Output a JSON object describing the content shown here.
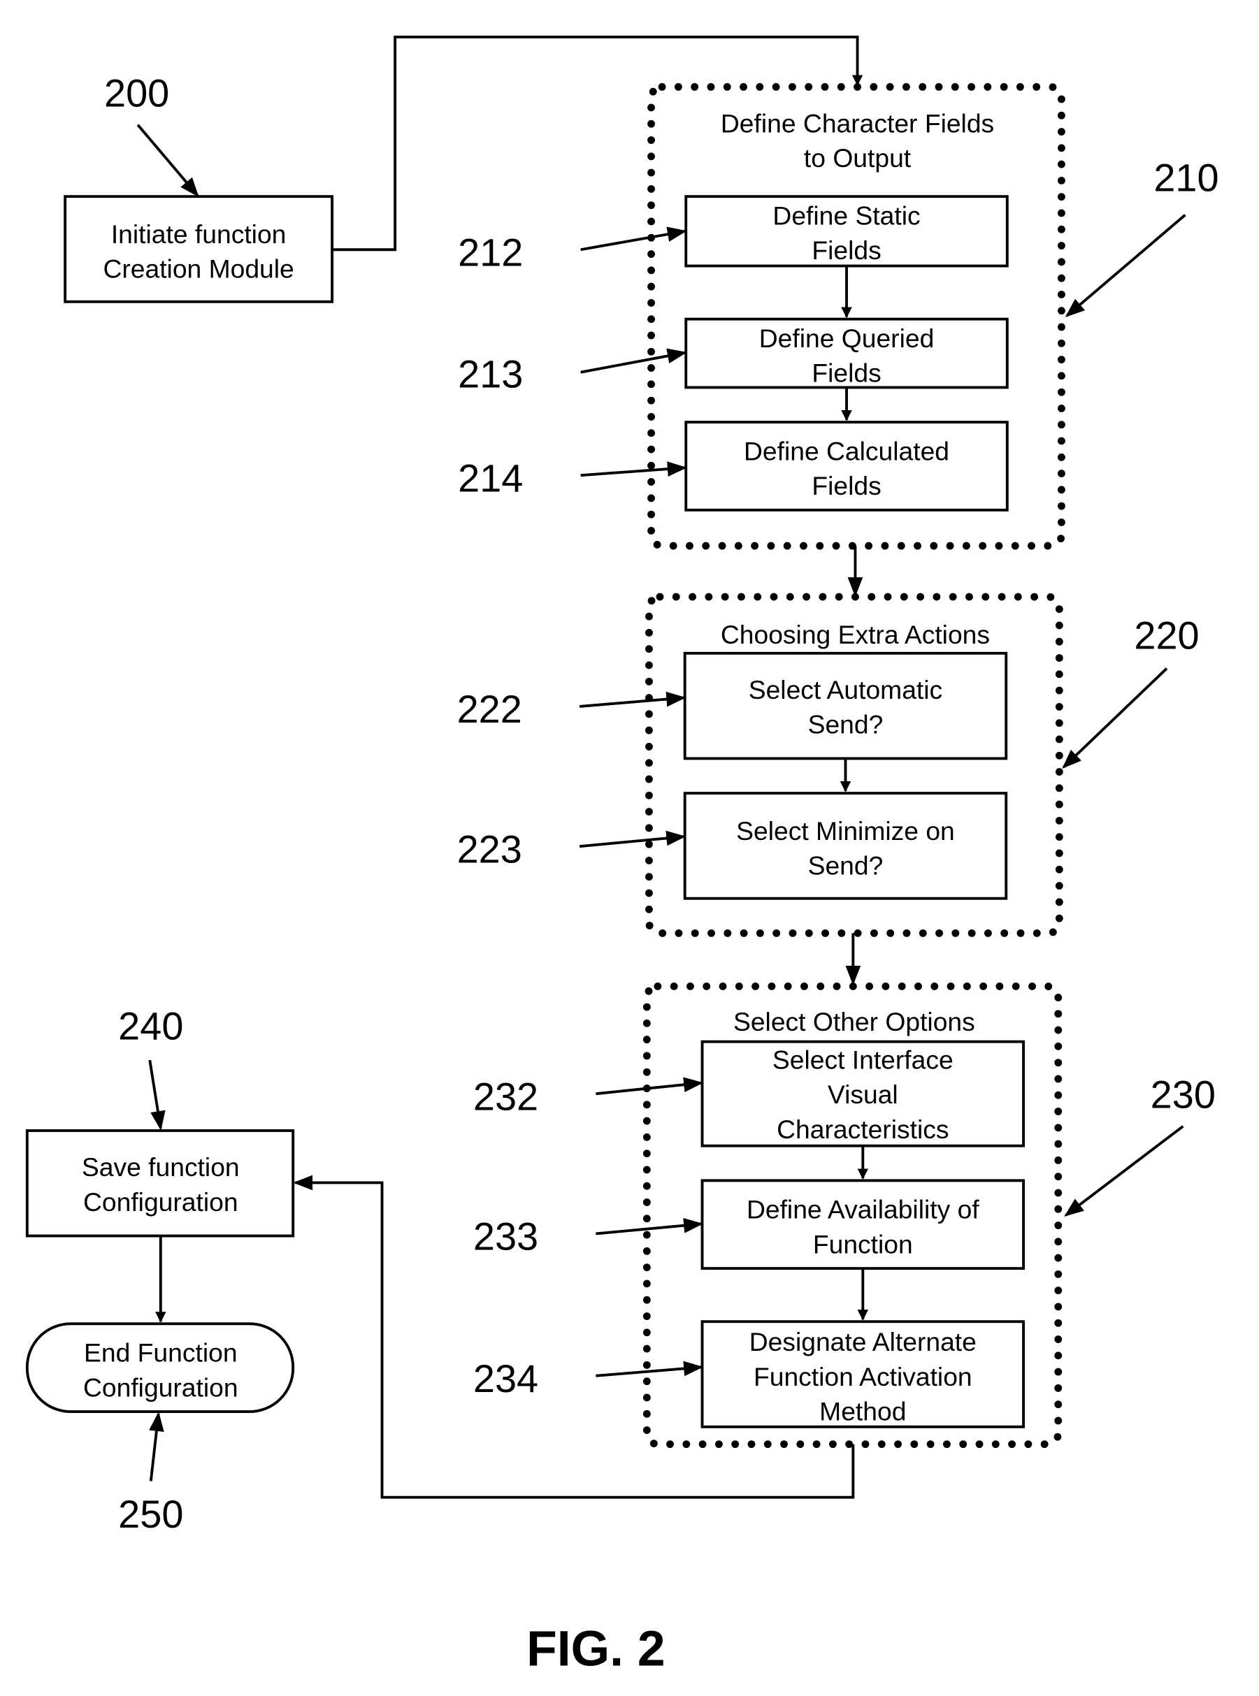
{
  "figure": {
    "caption": "FIG. 2"
  },
  "nodes": {
    "n200": {
      "ref": "200",
      "lines": [
        "Initiate function",
        "Creation Module"
      ]
    },
    "g210": {
      "ref": "210",
      "title": [
        "Define Character Fields",
        "to Output"
      ]
    },
    "n212": {
      "ref": "212",
      "lines": [
        "Define Static",
        "Fields"
      ]
    },
    "n213": {
      "ref": "213",
      "lines": [
        "Define Queried",
        "Fields"
      ]
    },
    "n214": {
      "ref": "214",
      "lines": [
        "Define Calculated",
        "Fields"
      ]
    },
    "g220": {
      "ref": "220",
      "title": [
        "Choosing Extra Actions"
      ]
    },
    "n222": {
      "ref": "222",
      "lines": [
        "Select Automatic",
        "Send?"
      ]
    },
    "n223": {
      "ref": "223",
      "lines": [
        "Select Minimize on",
        "Send?"
      ]
    },
    "g230": {
      "ref": "230",
      "title": [
        "Select Other Options"
      ]
    },
    "n232": {
      "ref": "232",
      "lines": [
        "Select Interface",
        "Visual",
        "Characteristics"
      ]
    },
    "n233": {
      "ref": "233",
      "lines": [
        "Define Availability of",
        "Function"
      ]
    },
    "n234": {
      "ref": "234",
      "lines": [
        "Designate Alternate",
        "Function Activation",
        "Method"
      ]
    },
    "n240": {
      "ref": "240",
      "lines": [
        "Save function",
        "Configuration"
      ]
    },
    "n250": {
      "ref": "250",
      "lines": [
        "End Function",
        "Configuration"
      ]
    }
  }
}
